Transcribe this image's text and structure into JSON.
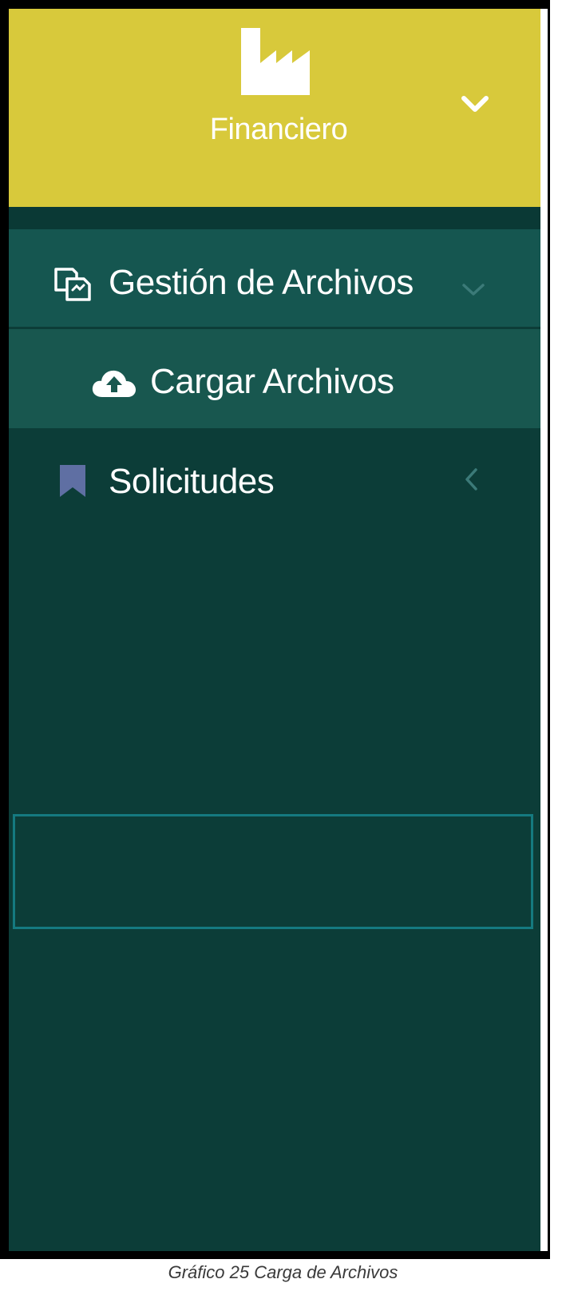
{
  "header": {
    "title": "Financiero",
    "icon": "factory-icon",
    "toggle_icon": "chevron-down-icon",
    "background": "#d8c93b"
  },
  "menu": {
    "items": [
      {
        "label": "Gestión de Archivos",
        "icon": "files-icon",
        "indicator": "chevron-down-icon",
        "state": "expanded"
      },
      {
        "label": "Cargar Archivos",
        "icon": "cloud-upload-icon",
        "state": "active-submenu"
      },
      {
        "label": "Solicitudes",
        "icon": "bookmark-icon",
        "indicator": "chevron-left-icon",
        "state": "collapsed"
      }
    ]
  },
  "colors": {
    "sidebar_bg": "#0c3d38",
    "active_bg": "#155650",
    "highlight_border": "#157a80",
    "bookmark": "#5f6fa3"
  },
  "caption": "Gráfico 25 Carga de Archivos"
}
